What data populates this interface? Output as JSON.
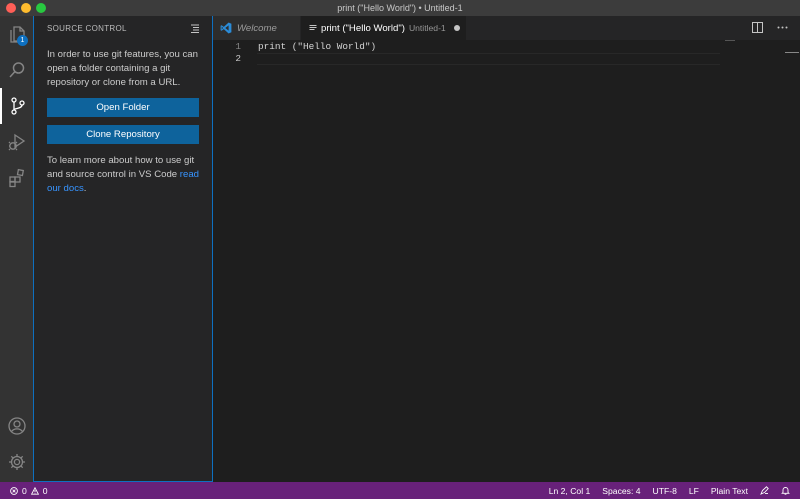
{
  "window": {
    "title": "print (\"Hello World\") • Untitled-1"
  },
  "activity_bar": {
    "items": [
      {
        "name": "explorer",
        "icon": "files-icon",
        "badge": "1"
      },
      {
        "name": "search",
        "icon": "search-icon"
      },
      {
        "name": "source-control",
        "icon": "source-control-icon",
        "active": true
      },
      {
        "name": "run-debug",
        "icon": "run-debug-icon"
      },
      {
        "name": "extensions",
        "icon": "extensions-icon"
      }
    ],
    "bottom": [
      {
        "name": "accounts",
        "icon": "account-icon"
      },
      {
        "name": "manage",
        "icon": "gear-icon"
      }
    ]
  },
  "sidebar": {
    "title": "SOURCE CONTROL",
    "message": "In order to use git features, you can open a folder containing a git repository or clone from a URL.",
    "open_folder": "Open Folder",
    "clone_repo": "Clone Repository",
    "learn_more_prefix": "To learn more about how to use git and source control in VS Code ",
    "learn_more_link": "read our docs",
    "learn_more_suffix": "."
  },
  "tabs": [
    {
      "label": "Welcome",
      "icon": "vscode-logo-icon"
    },
    {
      "label": "print (\"Hello World\")",
      "description": "Untitled-1",
      "icon": "text-file-icon",
      "dirty": true
    }
  ],
  "editor": {
    "lines": [
      {
        "number": "1",
        "text": "print (\"Hello World\")"
      },
      {
        "number": "2",
        "text": ""
      }
    ]
  },
  "status_bar": {
    "errors": "0",
    "warnings": "0",
    "position": "Ln 2, Col 1",
    "spaces": "Spaces: 4",
    "encoding": "UTF-8",
    "eol": "LF",
    "language": "Plain Text"
  },
  "colors": {
    "accent": "#0e70c0",
    "status_bar": "#68217a",
    "button": "#0e639c",
    "link": "#3794ff"
  }
}
